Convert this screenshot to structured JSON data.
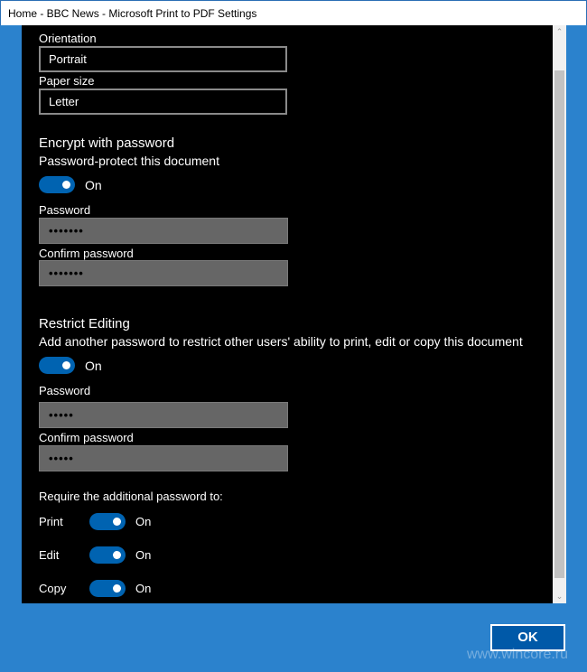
{
  "window": {
    "title": "Home - BBC News - Microsoft Print to PDF Settings"
  },
  "layout": {
    "orientation_label": "Orientation",
    "orientation_value": "Portrait",
    "paper_label": "Paper size",
    "paper_value": "Letter"
  },
  "encrypt": {
    "heading": "Encrypt with password",
    "subheading": "Password-protect this document",
    "toggle": "On",
    "password_label": "Password",
    "password_value": "•••••••",
    "confirm_label": "Confirm password",
    "confirm_value": "•••••••"
  },
  "restrict": {
    "heading": "Restrict Editing",
    "subheading": "Add another password to restrict other users' ability to print, edit or copy this document",
    "toggle": "On",
    "password_label": "Password",
    "password_value": "•••••",
    "confirm_label": "Confirm password",
    "confirm_value": "•••••"
  },
  "require": {
    "label": "Require the additional password to:",
    "items": [
      {
        "label": "Print",
        "state": "On"
      },
      {
        "label": "Edit",
        "state": "On"
      },
      {
        "label": "Copy",
        "state": "On"
      }
    ]
  },
  "ok_label": "OK",
  "watermark": "www.wincore.ru",
  "colors": {
    "accent": "#0063b1",
    "background": "#2b82cd"
  }
}
